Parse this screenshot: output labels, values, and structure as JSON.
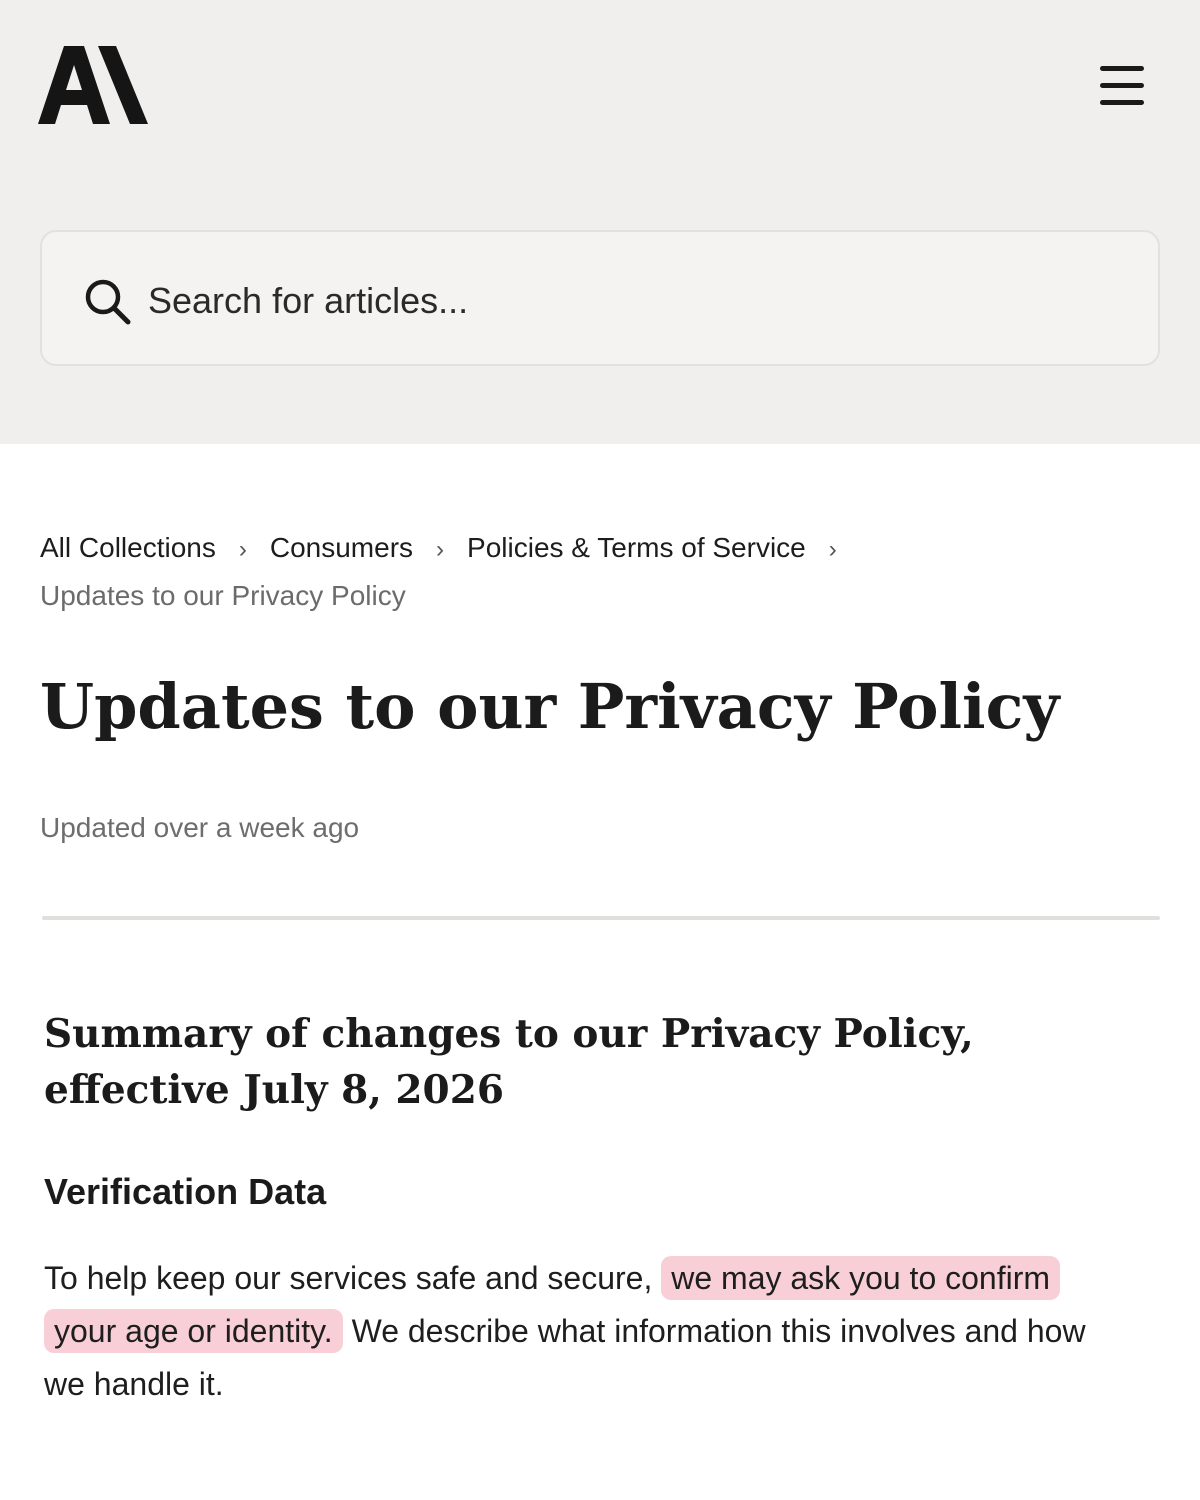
{
  "header": {
    "logo_text": "A\\",
    "logo_icon": "anthropic-logo",
    "menu_icon": "hamburger-menu-icon"
  },
  "search": {
    "placeholder": "Search for articles...",
    "icon": "search-icon"
  },
  "breadcrumb": {
    "items": [
      "All Collections",
      "Consumers",
      "Policies & Terms of Service"
    ],
    "separator": "›",
    "current": "Updates to our Privacy Policy"
  },
  "article": {
    "title": "Updates to our Privacy Policy",
    "updated": "Updated over a week ago",
    "summary_heading_line1": "Summary of changes to our Privacy Policy,",
    "summary_heading_line2": "effective July 8, 2026",
    "section_heading": "Verification Data",
    "paragraph": {
      "part1": "To help keep our services safe and secure, ",
      "highlight1": "we may ask you to confirm",
      "highlight2": "your age or identity.",
      "part2": " We describe what information this involves and how",
      "part3": "we handle it."
    }
  },
  "colors": {
    "header_bg": "#f0efed",
    "highlight": "#f8cfd6",
    "text": "#1a1a1a",
    "muted": "#6b6b6b"
  }
}
